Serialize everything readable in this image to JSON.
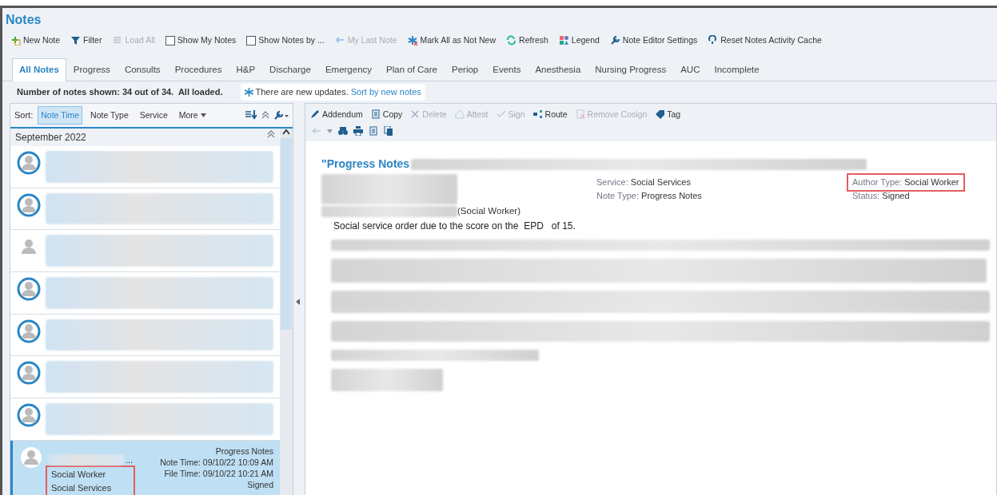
{
  "title": "Notes",
  "toolbar": [
    {
      "kind": "button",
      "label": "New Note",
      "disabled": false
    },
    {
      "kind": "button",
      "label": "Filter",
      "disabled": false
    },
    {
      "kind": "button",
      "label": "Load All",
      "disabled": true
    },
    {
      "kind": "checkbox",
      "label": "Show My Notes",
      "checked": false
    },
    {
      "kind": "checkbox",
      "label": "Show Notes by ...",
      "checked": false
    },
    {
      "kind": "button",
      "label": "My Last Note",
      "disabled": true
    },
    {
      "kind": "button",
      "label": "Mark All as Not New",
      "disabled": false
    },
    {
      "kind": "button",
      "label": "Refresh",
      "disabled": false
    },
    {
      "kind": "button",
      "label": "Legend",
      "disabled": false
    },
    {
      "kind": "button",
      "label": "Note Editor Settings",
      "disabled": false
    },
    {
      "kind": "button",
      "label": "Reset Notes Activity Cache",
      "disabled": false
    }
  ],
  "tabs": [
    {
      "label": "All Notes",
      "selected": true
    },
    {
      "label": "Progress",
      "selected": false
    },
    {
      "label": "Consults",
      "selected": false
    },
    {
      "label": "Procedures",
      "selected": false
    },
    {
      "label": "H&P",
      "selected": false
    },
    {
      "label": "Discharge",
      "selected": false
    },
    {
      "label": "Emergency",
      "selected": false
    },
    {
      "label": "Plan of Care",
      "selected": false
    },
    {
      "label": "Periop",
      "selected": false
    },
    {
      "label": "Events",
      "selected": false
    },
    {
      "label": "Anesthesia",
      "selected": false
    },
    {
      "label": "Nursing Progress",
      "selected": false
    },
    {
      "label": "AUC",
      "selected": false
    },
    {
      "label": "Incomplete",
      "selected": false
    }
  ],
  "summary": "Number of notes shown: 34 out of 34.  All loaded.",
  "update_banner": {
    "text": "There are new updates.",
    "link": "Sort by new notes"
  },
  "sort_bar": {
    "label": "Sort:",
    "options": [
      {
        "label": "Note Time",
        "selected": true
      },
      {
        "label": "Note Type",
        "selected": false
      },
      {
        "label": "Service",
        "selected": false
      }
    ],
    "more": "More"
  },
  "group_header": "September 2022",
  "notes": [
    {
      "kind": "blurred",
      "new": true,
      "selected": false
    },
    {
      "kind": "blurred",
      "new": true,
      "selected": false
    },
    {
      "kind": "blurred",
      "new": false,
      "selected": false
    },
    {
      "kind": "blurred",
      "new": true,
      "selected": false
    },
    {
      "kind": "blurred",
      "new": true,
      "selected": false
    },
    {
      "kind": "blurred",
      "new": true,
      "selected": false
    },
    {
      "kind": "blurred",
      "new": true,
      "selected": false
    },
    {
      "kind": "shown",
      "new": false,
      "selected": true,
      "name_tail": "...",
      "author_type": "Social Worker",
      "service": "Social Services",
      "highlighted": true,
      "note_type": "Progress Notes",
      "note_time": "Note Time: 09/10/22 10:09 AM",
      "file_time": "File Time: 09/10/22 10:21 AM",
      "status": "Signed"
    }
  ],
  "editor_toolbar": [
    {
      "label": "Addendum",
      "disabled": false
    },
    {
      "label": "Copy",
      "disabled": false
    },
    {
      "label": "Delete",
      "disabled": true
    },
    {
      "label": "Attest",
      "disabled": true
    },
    {
      "label": "Sign",
      "disabled": true
    },
    {
      "label": "Route",
      "disabled": false
    },
    {
      "label": "Remove Cosign",
      "disabled": true
    },
    {
      "label": "Tag",
      "disabled": false
    }
  ],
  "note": {
    "title": "\"Progress Notes",
    "author_suffix": "(Social Worker)",
    "fields": [
      {
        "label": "Service:",
        "value": "Social Services",
        "highlighted": false
      },
      {
        "label": "Note Type:",
        "value": "Progress Notes",
        "highlighted": false
      },
      {
        "label": "Author Type:",
        "value": "Social Worker",
        "highlighted": true
      },
      {
        "label": "Status:",
        "value": "Signed",
        "highlighted": false
      }
    ],
    "body": "Social service order due to the score on the  EPD   of 15."
  }
}
